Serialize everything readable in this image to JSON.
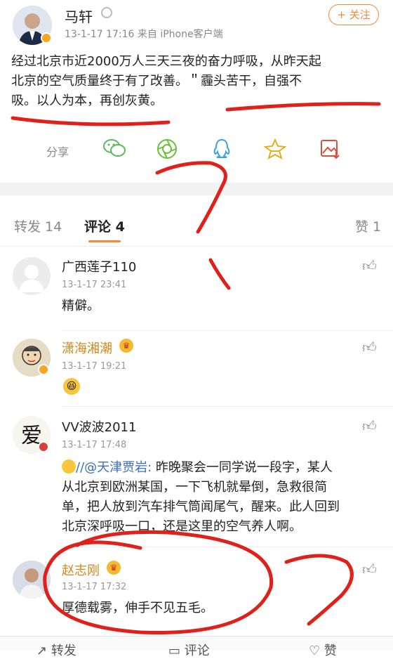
{
  "post": {
    "author": "马轩",
    "meta": "13-1-17 17:16  来自 iPhone客户端",
    "follow_label": "+ 关注",
    "text_lines": [
      "经过北京市近2000万人三天三夜的奋力呼吸，从昨天起",
      "北京的空气质量终于有了改善。＂霾头苦干，自强不",
      "吸。以人为本，再创灰黄。"
    ],
    "share_label": "分享"
  },
  "tabs": {
    "repost": "转发 14",
    "comment": "评论 4",
    "like": "赞 1"
  },
  "comments": [
    {
      "name": "广西莲子110",
      "time": "13-1-17 23:41",
      "lines": [
        "精僻。"
      ]
    },
    {
      "name": "潇海湘潮",
      "time": "13-1-17 19:21",
      "lines": []
    },
    {
      "name": "VV波波2011",
      "time": "13-1-17 17:48",
      "mention": "//@天津贾岩:",
      "lines": [
        " 昨晚聚会一同学说一段字，某人",
        "从北京到欧洲某国，一下飞机就晕倒，急救很简",
        "单，把人放到汽车排气筒闻尾气，醒来。此人回到",
        "北京深呼吸一口，还是这里的空气养人啊。"
      ]
    },
    {
      "name": "赵志刚",
      "time": "13-1-17 17:32",
      "lines": [
        "厚德载雾，伸手不见五毛。"
      ]
    }
  ],
  "bottom_bar": {
    "repost": "转发",
    "comment": "评论",
    "like": "赞"
  },
  "colors": {
    "annotation_red": "#e0201a",
    "gold_name": "#d4871a",
    "link_blue": "#3b6fb6"
  }
}
